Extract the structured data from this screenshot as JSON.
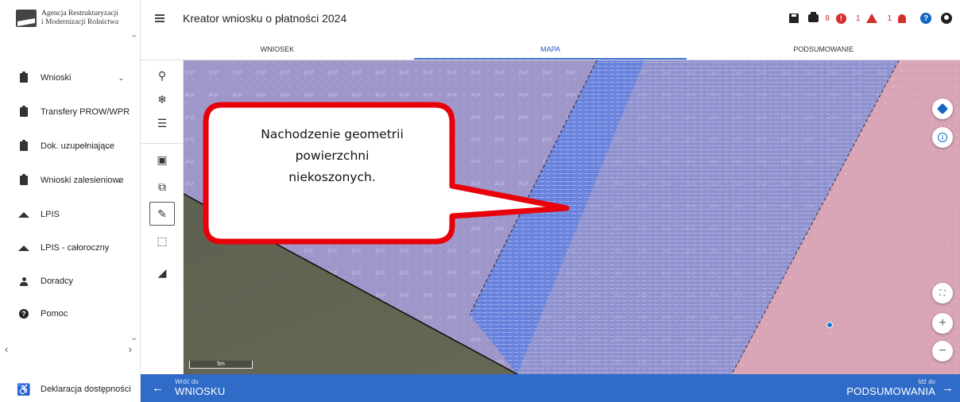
{
  "sidebar": {
    "logo_line1": "Agencja Restrukturyzacji",
    "logo_line2": "i Modernizacji Rolnictwa",
    "items": [
      {
        "label": "Wnioski",
        "icon": "clipboard-icon",
        "chevron": "⌄"
      },
      {
        "label": "Transfery PROW/WPR",
        "icon": "clipboard-icon"
      },
      {
        "label": "Dok. uzupełniające",
        "icon": "clipboard-icon",
        "chevron": "⌄"
      },
      {
        "label": "Wnioski zalesieniowe",
        "icon": "clipboard-icon",
        "chevron": "⌄"
      },
      {
        "label": "LPIS",
        "icon": "terrain-icon"
      },
      {
        "label": "LPIS - całoroczny",
        "icon": "terrain-icon"
      },
      {
        "label": "Doradcy",
        "icon": "person-icon"
      },
      {
        "label": "Pomoc",
        "icon": "help-icon"
      }
    ],
    "accessibility_label": "Deklaracja dostępności"
  },
  "header": {
    "title": "Kreator wniosku o płatności 2024",
    "error_count": "8",
    "warning_count": "1",
    "notification_count": "1"
  },
  "tabs": [
    {
      "label": "WNIOSEK",
      "active": false
    },
    {
      "label": "MAPA",
      "active": true
    },
    {
      "label": "PODSUMOWANIE",
      "active": false
    }
  ],
  "map": {
    "scale_label": "5m",
    "callout_lines": [
      "Nachodzenie geometrii",
      "powierzchni",
      "niekoszonych."
    ],
    "colors": {
      "purple_layer": "#9f97c9",
      "blue_strip": "#5f7fe0",
      "pink_layer": "#d8a4b6",
      "callout_border": "#e8000b"
    }
  },
  "footer": {
    "back_small": "Wróć do",
    "back_big": "WNIOSKU",
    "next_small": "Idź do",
    "next_big": "PODSUMOWANIA"
  }
}
